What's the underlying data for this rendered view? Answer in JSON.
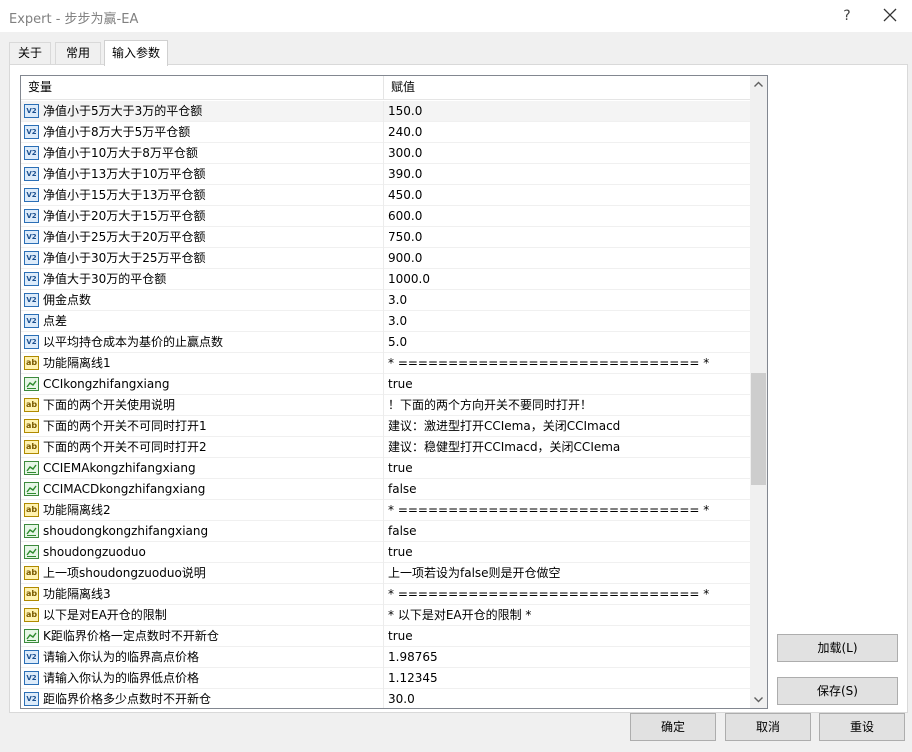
{
  "window": {
    "title": "Expert - 步步为赢-EA",
    "help_glyph": "?"
  },
  "tabs": [
    {
      "label": "关于"
    },
    {
      "label": "常用"
    },
    {
      "label": "输入参数"
    }
  ],
  "grid": {
    "col_variable": "变量",
    "col_value": "赋值",
    "rows": [
      {
        "name": "净值小于5万大于3万的平仓额",
        "value": "150.0",
        "type": "double"
      },
      {
        "name": "净值小于8万大于5万平仓额",
        "value": "240.0",
        "type": "double"
      },
      {
        "name": "净值小于10万大于8万平仓额",
        "value": "300.0",
        "type": "double"
      },
      {
        "name": "净值小于13万大于10万平仓额",
        "value": "390.0",
        "type": "double"
      },
      {
        "name": "净值小于15万大于13万平仓额",
        "value": "450.0",
        "type": "double"
      },
      {
        "name": "净值小于20万大于15万平仓额",
        "value": "600.0",
        "type": "double"
      },
      {
        "name": "净值小于25万大于20万平仓额",
        "value": "750.0",
        "type": "double"
      },
      {
        "name": "净值小于30万大于25万平仓额",
        "value": "900.0",
        "type": "double"
      },
      {
        "name": "净值大于30万的平仓额",
        "value": "1000.0",
        "type": "double"
      },
      {
        "name": "佣金点数",
        "value": "3.0",
        "type": "double"
      },
      {
        "name": "点差",
        "value": "3.0",
        "type": "double"
      },
      {
        "name": "以平均持仓成本为基价的止赢点数",
        "value": "5.0",
        "type": "double"
      },
      {
        "name": "功能隔离线1",
        "value": "* ============================== *",
        "type": "string"
      },
      {
        "name": "CCIkongzhifangxiang",
        "value": "true",
        "type": "bool"
      },
      {
        "name": "下面的两个开关使用说明",
        "value": "！下面的两个方向开关不要同时打开！",
        "type": "string"
      },
      {
        "name": "下面的两个开关不可同时打开1",
        "value": "建议：激进型打开CCIema，关闭CCImacd",
        "type": "string"
      },
      {
        "name": "下面的两个开关不可同时打开2",
        "value": "建议：稳健型打开CCImacd，关闭CCIema",
        "type": "string"
      },
      {
        "name": "CCIEMAkongzhifangxiang",
        "value": "true",
        "type": "bool"
      },
      {
        "name": "CCIMACDkongzhifangxiang",
        "value": "false",
        "type": "bool"
      },
      {
        "name": "功能隔离线2",
        "value": "* ============================== *",
        "type": "string"
      },
      {
        "name": "shoudongkongzhifangxiang",
        "value": "false",
        "type": "bool"
      },
      {
        "name": "shoudongzuoduo",
        "value": "true",
        "type": "bool"
      },
      {
        "name": "上一项shoudongzuoduo说明",
        "value": "上一项若设为false则是开仓做空",
        "type": "string"
      },
      {
        "name": "功能隔离线3",
        "value": "* ============================== *",
        "type": "string"
      },
      {
        "name": "以下是对EA开仓的限制",
        "value": "* 以下是对EA开仓的限制 *",
        "type": "string"
      },
      {
        "name": "K距临界价格一定点数时不开新仓",
        "value": "true",
        "type": "bool"
      },
      {
        "name": "请输入你认为的临界高点价格",
        "value": "1.98765",
        "type": "double"
      },
      {
        "name": "请输入你认为的临界低点价格",
        "value": "1.12345",
        "type": "double"
      },
      {
        "name": "距临界价格多少点数时不开新仓",
        "value": "30.0",
        "type": "double"
      }
    ]
  },
  "icons": {
    "double": "V2",
    "string": "ab",
    "bool": "bool-icon"
  },
  "buttons": {
    "load": "加载(L)",
    "save": "保存(S)",
    "ok": "确定",
    "cancel": "取消",
    "reset": "重设"
  }
}
